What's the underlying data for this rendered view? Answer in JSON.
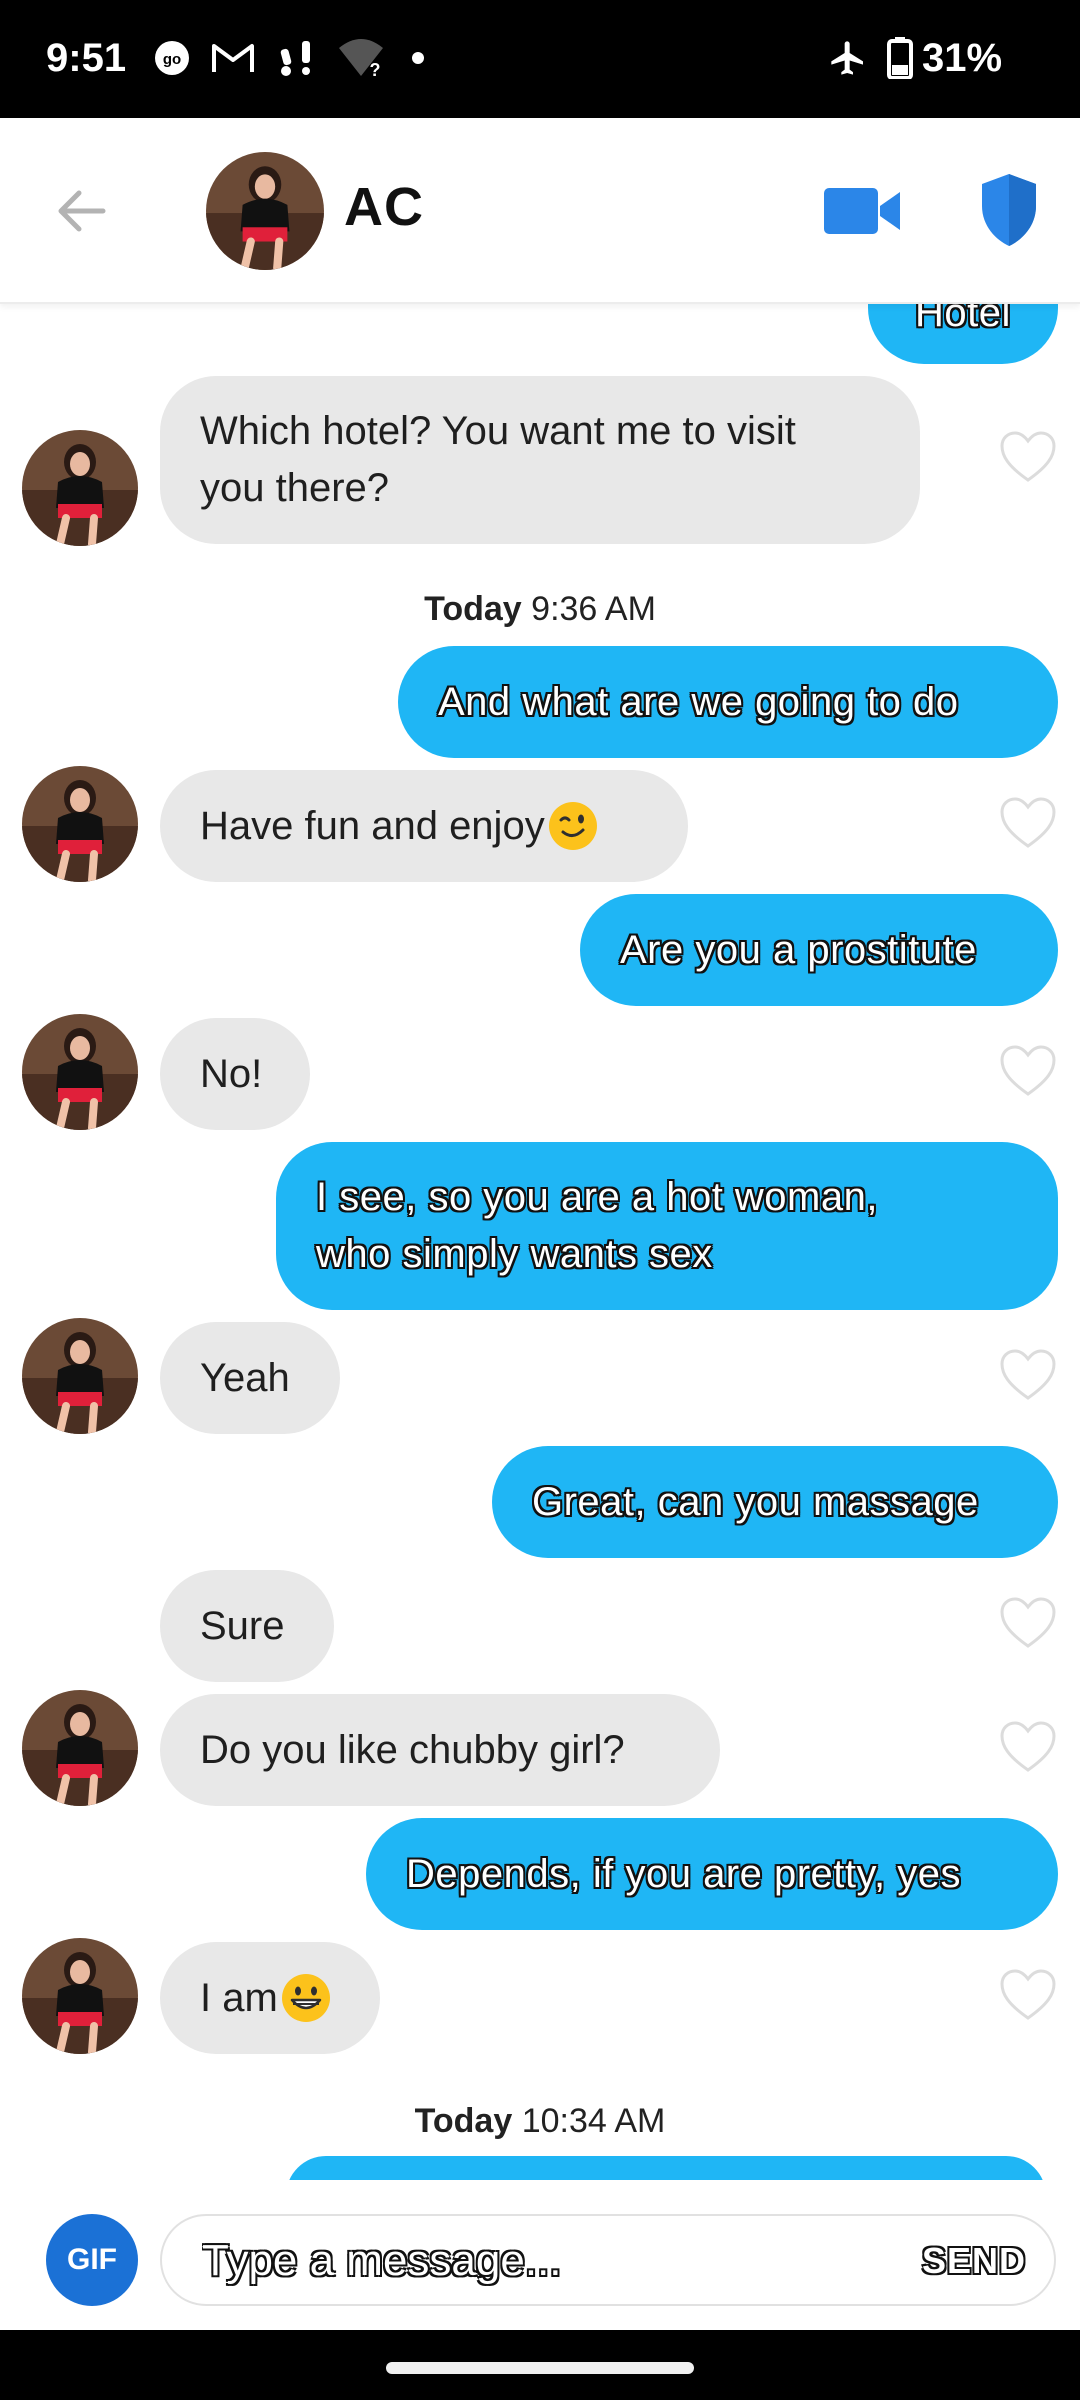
{
  "status_bar": {
    "time": "9:51",
    "battery_percent": "31%",
    "icons": [
      "go-icon",
      "gmail-icon",
      "alert-icon",
      "wifi-question-icon",
      "dot-icon",
      "airplane-icon",
      "battery-icon"
    ]
  },
  "header": {
    "contact_name": "AC",
    "icons": [
      "back-arrow-icon",
      "video-camera-icon",
      "shield-icon"
    ],
    "accent_color": "#2b86e8"
  },
  "chat": {
    "partial_top_message": "Hotel",
    "messages": [
      {
        "from": "them",
        "text": "Which hotel? You want me to visit you there?",
        "lines": [
          "Which hotel? You want me to visit",
          "you there?"
        ]
      },
      {
        "from": "timestamp",
        "day": "Today",
        "time": "9:36 AM"
      },
      {
        "from": "me",
        "text": "And what are we going to do"
      },
      {
        "from": "them",
        "text": "Have fun and enjoy",
        "emoji": "winking-face"
      },
      {
        "from": "me",
        "text": "Are you a prostitute"
      },
      {
        "from": "them",
        "text": "No!"
      },
      {
        "from": "me",
        "text": "I see, so you are a hot woman, who simply wants sex",
        "lines": [
          "I see, so you are a hot woman,",
          "who simply wants sex"
        ]
      },
      {
        "from": "them",
        "text": "Yeah"
      },
      {
        "from": "me",
        "text": "Great, can you massage"
      },
      {
        "from": "them",
        "text": "Sure"
      },
      {
        "from": "them",
        "text": "Do you like chubby girl?"
      },
      {
        "from": "me",
        "text": "Depends, if you are pretty, yes"
      },
      {
        "from": "them",
        "text": "I am",
        "emoji": "grinning-face"
      },
      {
        "from": "timestamp",
        "day": "Today",
        "time": "10:34 AM"
      }
    ],
    "colors": {
      "incoming": "#e8e8e8",
      "outgoing": "#1fb6f5"
    }
  },
  "composer": {
    "gif_label": "GIF",
    "placeholder": "Type a message...",
    "send_label": "SEND"
  }
}
